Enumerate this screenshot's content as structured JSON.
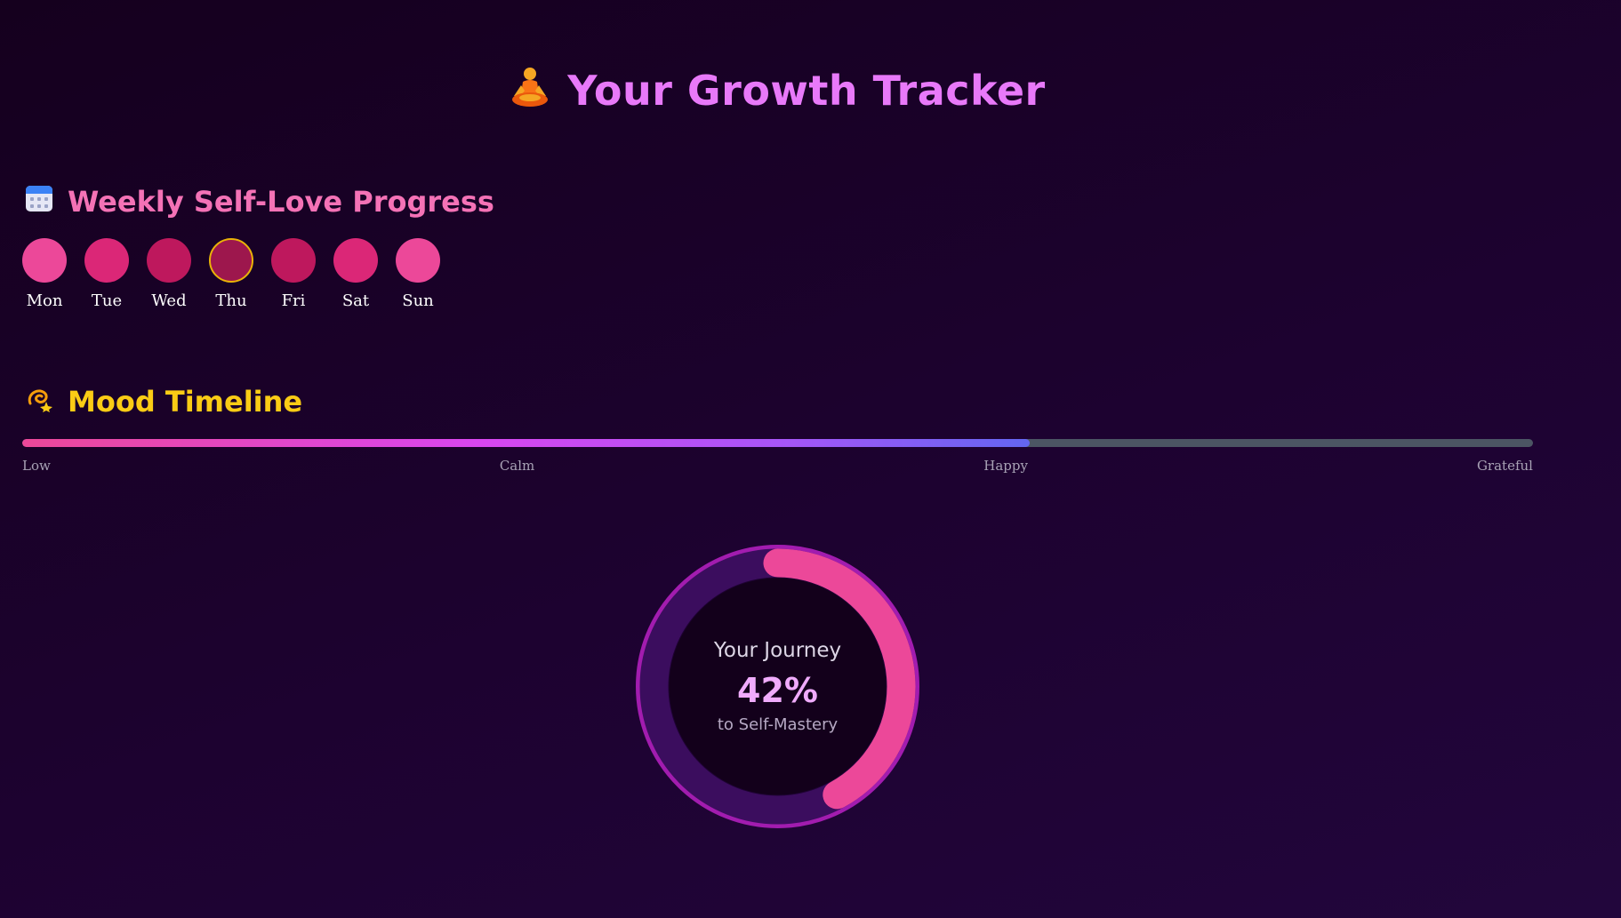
{
  "app": {
    "title": "Your Growth Tracker",
    "title_icon": "person-in-lotus-position-icon"
  },
  "weekly": {
    "heading": "Weekly Self-Love Progress",
    "heading_icon": "calendar-icon",
    "days": [
      {
        "label": "Mon",
        "color": "#ec4899",
        "current": false
      },
      {
        "label": "Tue",
        "color": "#db2777",
        "current": false
      },
      {
        "label": "Wed",
        "color": "#be185d",
        "current": false
      },
      {
        "label": "Thu",
        "color": "#9d174d",
        "current": true
      },
      {
        "label": "Fri",
        "color": "#be185d",
        "current": false
      },
      {
        "label": "Sat",
        "color": "#db2777",
        "current": false
      },
      {
        "label": "Sun",
        "color": "#ec4899",
        "current": false
      }
    ],
    "current_ring_color": "#eab308"
  },
  "mood": {
    "heading": "Mood Timeline",
    "heading_icon": "dizzy-star-icon",
    "progress": 0.667,
    "labels": [
      "Low",
      "Calm",
      "Happy",
      "Grateful"
    ]
  },
  "journey": {
    "title": "Your Journey",
    "value": "42%",
    "progress": 0.42,
    "subtitle": "to Self-Mastery",
    "colors": {
      "outer_ring": "#a21caf",
      "track": "#3b0d5e",
      "arc": "#ec4899",
      "inner": "#13001b"
    }
  }
}
